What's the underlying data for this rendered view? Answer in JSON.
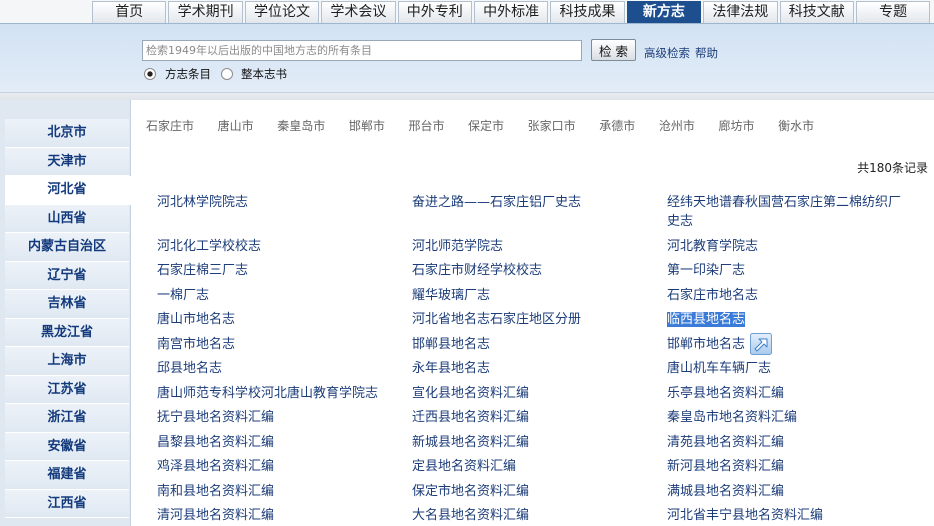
{
  "theme": {
    "active_tab_bg": "#1d4f8f",
    "link_color": "#1c3d7a",
    "sidebar_text_color": "#133a7c",
    "selection_bg": "#3b7bd8"
  },
  "nav": {
    "tabs": [
      {
        "label": "首页"
      },
      {
        "label": "学术期刊"
      },
      {
        "label": "学位论文"
      },
      {
        "label": "学术会议"
      },
      {
        "label": "中外专利"
      },
      {
        "label": "中外标准"
      },
      {
        "label": "科技成果"
      },
      {
        "label": "新方志",
        "active": true
      },
      {
        "label": "法律法规"
      },
      {
        "label": "科技文献"
      },
      {
        "label": "专题"
      }
    ]
  },
  "search": {
    "value": "",
    "placeholder": "检索1949年以后出版的中国地方志的所有条目",
    "button_label": "检 索",
    "advanced_link": "高级检索",
    "help_link": "帮助",
    "scope_options": [
      {
        "label": "方志条目",
        "checked": true
      },
      {
        "label": "整本志书",
        "checked": false
      }
    ]
  },
  "sidebar": {
    "items": [
      {
        "label": "北京市"
      },
      {
        "label": "天津市"
      },
      {
        "label": "河北省",
        "active": true
      },
      {
        "label": "山西省"
      },
      {
        "label": "内蒙古自治区"
      },
      {
        "label": "辽宁省"
      },
      {
        "label": "吉林省"
      },
      {
        "label": "黑龙江省"
      },
      {
        "label": "上海市"
      },
      {
        "label": "江苏省"
      },
      {
        "label": "浙江省"
      },
      {
        "label": "安徽省"
      },
      {
        "label": "福建省"
      },
      {
        "label": "江西省"
      }
    ]
  },
  "main": {
    "cities": [
      "石家庄市",
      "唐山市",
      "秦皇岛市",
      "邯郸市",
      "邢台市",
      "保定市",
      "张家口市",
      "承德市",
      "沧州市",
      "廊坊市",
      "衡水市"
    ],
    "record_count": "共180条记录",
    "results": [
      {
        "title": "河北林学院院志"
      },
      {
        "title": "奋进之路——石家庄铝厂史志"
      },
      {
        "title": "经纬天地谱春秋国营石家庄第二棉纺织厂史志"
      },
      {
        "title": "河北化工学校校志"
      },
      {
        "title": "河北师范学院志"
      },
      {
        "title": "河北教育学院志"
      },
      {
        "title": "石家庄棉三厂志"
      },
      {
        "title": "石家庄市财经学校校志"
      },
      {
        "title": "第一印染厂志"
      },
      {
        "title": "一棉厂志"
      },
      {
        "title": "耀华玻璃厂志"
      },
      {
        "title": "石家庄市地名志"
      },
      {
        "title": "唐山市地名志"
      },
      {
        "title": "河北省地名志石家庄地区分册"
      },
      {
        "title": "临西县地名志",
        "selected": true
      },
      {
        "title": "南宫市地名志"
      },
      {
        "title": "邯郸县地名志"
      },
      {
        "title": "邯郸市地名志",
        "icon": "external-link-icon"
      },
      {
        "title": "邱县地名志"
      },
      {
        "title": "永年县地名志"
      },
      {
        "title": "唐山机车车辆厂志"
      },
      {
        "title": "唐山师范专科学校河北唐山教育学院志"
      },
      {
        "title": "宣化县地名资料汇编"
      },
      {
        "title": "乐亭县地名资料汇编"
      },
      {
        "title": "抚宁县地名资料汇编"
      },
      {
        "title": "迁西县地名资料汇编"
      },
      {
        "title": "秦皇岛市地名资料汇编"
      },
      {
        "title": "昌黎县地名资料汇编"
      },
      {
        "title": "新城县地名资料汇编"
      },
      {
        "title": "清苑县地名资料汇编"
      },
      {
        "title": "鸡泽县地名资料汇编"
      },
      {
        "title": "定县地名资料汇编"
      },
      {
        "title": "新河县地名资料汇编"
      },
      {
        "title": "南和县地名资料汇编"
      },
      {
        "title": "保定市地名资料汇编"
      },
      {
        "title": "满城县地名资料汇编"
      },
      {
        "title": "清河县地名资料汇编"
      },
      {
        "title": "大名县地名资料汇编"
      },
      {
        "title": "河北省丰宁县地名资料汇编"
      }
    ]
  }
}
